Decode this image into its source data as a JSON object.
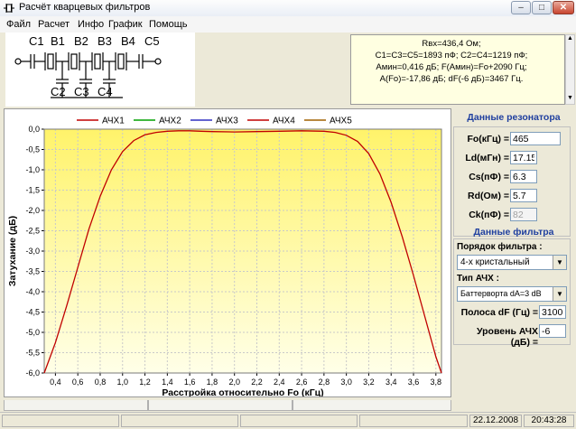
{
  "window": {
    "title": "Расчёт кварцевых фильтров",
    "min_label": "–",
    "max_label": "□",
    "close_label": "✕"
  },
  "menu": {
    "items": [
      "Файл",
      "Расчет",
      "Инфо",
      "График",
      "Помощь"
    ]
  },
  "circuit": {
    "top_labels": [
      "C1",
      "B1",
      "B2",
      "B3",
      "B4",
      "C5"
    ],
    "bottom_labels": [
      "C2",
      "C3",
      "C4"
    ]
  },
  "info": {
    "lines": [
      "Rвх=436,4 Ом;",
      "C1=C3=C5=1893 пФ; C2=C4=1219 пФ;",
      "Aмин=0,416 дБ; F(Aмин)=Fo+2090 Гц;",
      "A(Fo)=-17,86 дБ; dF(-6 дБ)=3467 Гц."
    ]
  },
  "resonator": {
    "title": "Данные резонатора",
    "fields": [
      {
        "label": "Fo(кГц) =",
        "value": "465",
        "disabled": false
      },
      {
        "label": "Ld(мГн) =",
        "value": "17.15",
        "disabled": false
      },
      {
        "label": "Cs(пФ) =",
        "value": "6.3",
        "disabled": false
      },
      {
        "label": "Rd(Ом) =",
        "value": "5.7",
        "disabled": false
      },
      {
        "label": "Ck(пФ) =",
        "value": "82",
        "disabled": true
      }
    ]
  },
  "filter": {
    "title": "Данные фильтра",
    "order_label": "Порядок фильтра :",
    "order_value": "4-х кристальный",
    "type_label": "Тип АЧХ :",
    "type_value": "Баттерворта dA=3 dB",
    "band_label": "Полоса dF (Гц) =",
    "band_value": "3100",
    "level_label": "Уровень АЧХ (дБ) =",
    "level_value": "-6"
  },
  "status": {
    "date": "22.12.2008",
    "time": "20:43:28"
  },
  "chart_data": {
    "type": "line",
    "xlabel": "Расстройка относительно Fo (кГц)",
    "ylabel": "Затухание (дБ)",
    "xlim": [
      0.3,
      3.85
    ],
    "ylim": [
      -6.0,
      0.0
    ],
    "xticks": [
      "0,4",
      "0,6",
      "0,8",
      "1,0",
      "1,2",
      "1,4",
      "1,6",
      "1,8",
      "2,0",
      "2,2",
      "2,4",
      "2,6",
      "2,8",
      "3,0",
      "3,2",
      "3,4",
      "3,6",
      "3,8"
    ],
    "yticks": [
      "0,0",
      "-0,5",
      "-1,0",
      "-1,5",
      "-2,0",
      "-2,5",
      "-3,0",
      "-3,5",
      "-4,0",
      "-4,5",
      "-5,0",
      "-5,5",
      "-6,0"
    ],
    "grid": true,
    "legend_position": "top-center",
    "series": [
      {
        "name": "АЧХ1",
        "color": "#c00000",
        "x": [
          0.3,
          0.4,
          0.5,
          0.6,
          0.7,
          0.8,
          0.9,
          1.0,
          1.1,
          1.2,
          1.3,
          1.4,
          1.5,
          1.6,
          1.7,
          1.8,
          2.0,
          2.2,
          2.4,
          2.6,
          2.8,
          2.9,
          3.0,
          3.1,
          3.2,
          3.3,
          3.4,
          3.5,
          3.6,
          3.7,
          3.8,
          3.85
        ],
        "y": [
          -6.0,
          -5.25,
          -4.35,
          -3.4,
          -2.45,
          -1.65,
          -1.0,
          -0.55,
          -0.28,
          -0.14,
          -0.08,
          -0.05,
          -0.04,
          -0.04,
          -0.05,
          -0.06,
          -0.07,
          -0.06,
          -0.05,
          -0.04,
          -0.05,
          -0.08,
          -0.15,
          -0.3,
          -0.6,
          -1.1,
          -1.8,
          -2.65,
          -3.6,
          -4.6,
          -5.6,
          -6.0
        ]
      },
      {
        "name": "АЧХ2",
        "color": "#00a000"
      },
      {
        "name": "АЧХ3",
        "color": "#3030c0"
      },
      {
        "name": "АЧХ4",
        "color": "#c00000"
      },
      {
        "name": "АЧХ5",
        "color": "#a06000"
      }
    ]
  }
}
